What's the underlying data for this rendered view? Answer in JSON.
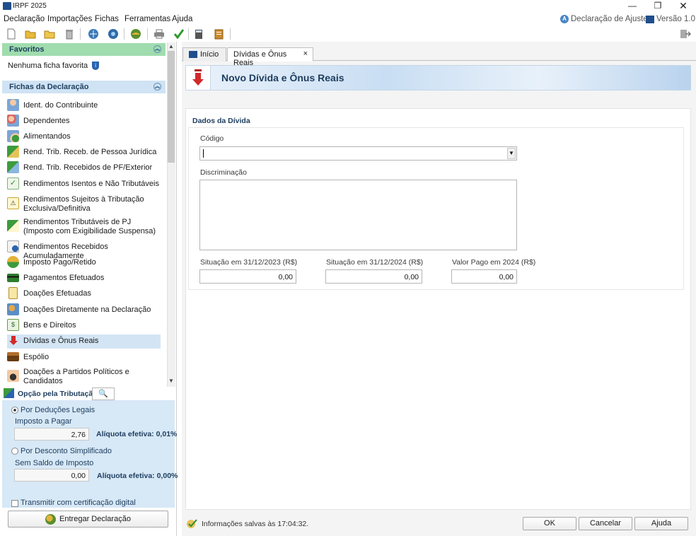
{
  "window": {
    "title": "IRPF 2025"
  },
  "menu": {
    "items": [
      "Declaração",
      "Importações",
      "Fichas",
      "Ferramentas",
      "Ajuda"
    ],
    "declaration_type": "Declaração de Ajuste",
    "version": "Versão 1.0"
  },
  "favorites": {
    "title": "Favoritos",
    "empty_text": "Nenhuma ficha favorita"
  },
  "fichas": {
    "title": "Fichas da Declaração",
    "items": [
      {
        "label": "Ident. do Contribuinte",
        "icon": "person-icon"
      },
      {
        "label": "Dependentes",
        "icon": "dependents-icon"
      },
      {
        "label": "Alimentandos",
        "icon": "alimentandos-icon"
      },
      {
        "label": "Rend. Trib. Receb. de Pessoa Jurídica",
        "icon": "income-pj-icon"
      },
      {
        "label": "Rend. Trib. Recebidos de PF/Exterior",
        "icon": "income-pf-icon"
      },
      {
        "label": "Rendimentos Isentos e Não Tributáveis",
        "icon": "exempt-income-icon"
      },
      {
        "label": "Rendimentos Sujeitos à Tributação Exclusiva/Definitiva",
        "icon": "exclusive-tax-icon"
      },
      {
        "label": "Rendimentos Tributáveis de PJ (Imposto com Exigibilidade Suspensa)",
        "icon": "suspended-tax-icon"
      },
      {
        "label": "Rendimentos Recebidos Acumuladamente",
        "icon": "accumulated-income-icon"
      },
      {
        "label": "Imposto Pago/Retido",
        "icon": "tax-paid-icon"
      },
      {
        "label": "Pagamentos Efetuados",
        "icon": "payments-icon"
      },
      {
        "label": "Doações Efetuadas",
        "icon": "donations-icon"
      },
      {
        "label": "Doações Diretamente na Declaração",
        "icon": "direct-donations-icon"
      },
      {
        "label": "Bens e Direitos",
        "icon": "assets-icon"
      },
      {
        "label": "Dívidas e Ônus Reais",
        "icon": "debts-icon",
        "selected": true
      },
      {
        "label": "Espólio",
        "icon": "estate-icon"
      },
      {
        "label": "Doações a Partidos Políticos e Candidatos",
        "icon": "political-donations-icon"
      }
    ]
  },
  "tributacao": {
    "title": "Opção pela Tributação:",
    "deducoes_label": "Por Deduções Legais",
    "imposto_pagar_label": "Imposto a Pagar",
    "imposto_pagar_value": "2,76",
    "aliquota_1": "Alíquota efetiva: 0,01%",
    "desconto_label": "Por Desconto Simplificado",
    "sem_saldo_label": "Sem Saldo de Imposto",
    "sem_saldo_value": "0,00",
    "aliquota_2": "Alíquota efetiva: 0,00%",
    "cert_label": "Transmitir com certificação digital",
    "entregar_label": "Entregar Declaração"
  },
  "tabs": [
    {
      "label": "Início",
      "active": false
    },
    {
      "label": "Dívidas e Ônus Reais",
      "active": true,
      "close": "×"
    }
  ],
  "banner": {
    "title": "Novo Dívida e Ônus Reais"
  },
  "form": {
    "section_title": "Dados da Dívida",
    "codigo_label": "Código",
    "codigo_value": "",
    "discriminacao_label": "Discriminação",
    "discriminacao_value": "",
    "sit2023_label": "Situação em 31/12/2023 (R$)",
    "sit2023_value": "0,00",
    "sit2024_label": "Situação em 31/12/2024 (R$)",
    "sit2024_value": "0,00",
    "pago_label": "Valor Pago em 2024 (R$)",
    "pago_value": "0,00"
  },
  "status": {
    "text": "Informações salvas às 17:04:32."
  },
  "buttons": {
    "ok": "OK",
    "cancel": "Cancelar",
    "help": "Ajuda"
  },
  "colors": {
    "accent": "#1d3d5e",
    "selection": "#d3e5f5",
    "favorites_header": "#9fdcae",
    "fichas_header": "#cfe3f4",
    "debt_arrow": "#d12a2a"
  }
}
